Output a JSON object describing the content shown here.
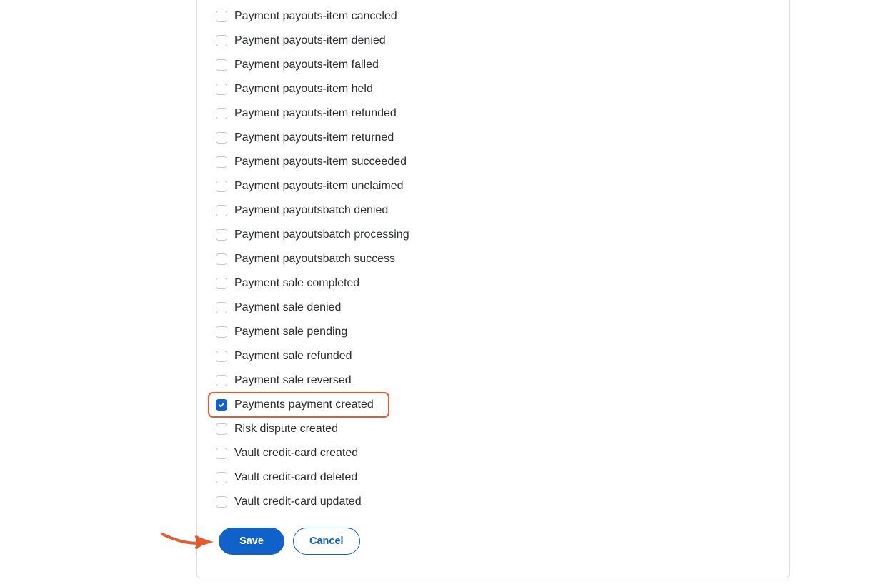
{
  "events": [
    {
      "label": "Payment payouts-item canceled",
      "checked": false,
      "highlight": false
    },
    {
      "label": "Payment payouts-item denied",
      "checked": false,
      "highlight": false
    },
    {
      "label": "Payment payouts-item failed",
      "checked": false,
      "highlight": false
    },
    {
      "label": "Payment payouts-item held",
      "checked": false,
      "highlight": false
    },
    {
      "label": "Payment payouts-item refunded",
      "checked": false,
      "highlight": false
    },
    {
      "label": "Payment payouts-item returned",
      "checked": false,
      "highlight": false
    },
    {
      "label": "Payment payouts-item succeeded",
      "checked": false,
      "highlight": false
    },
    {
      "label": "Payment payouts-item unclaimed",
      "checked": false,
      "highlight": false
    },
    {
      "label": "Payment payoutsbatch denied",
      "checked": false,
      "highlight": false
    },
    {
      "label": "Payment payoutsbatch processing",
      "checked": false,
      "highlight": false
    },
    {
      "label": "Payment payoutsbatch success",
      "checked": false,
      "highlight": false
    },
    {
      "label": "Payment sale completed",
      "checked": false,
      "highlight": false
    },
    {
      "label": "Payment sale denied",
      "checked": false,
      "highlight": false
    },
    {
      "label": "Payment sale pending",
      "checked": false,
      "highlight": false
    },
    {
      "label": "Payment sale refunded",
      "checked": false,
      "highlight": false
    },
    {
      "label": "Payment sale reversed",
      "checked": false,
      "highlight": false
    },
    {
      "label": "Payments payment created",
      "checked": true,
      "highlight": true
    },
    {
      "label": "Risk dispute created",
      "checked": false,
      "highlight": false
    },
    {
      "label": "Vault credit-card created",
      "checked": false,
      "highlight": false
    },
    {
      "label": "Vault credit-card deleted",
      "checked": false,
      "highlight": false
    },
    {
      "label": "Vault credit-card updated",
      "checked": false,
      "highlight": false
    }
  ],
  "buttons": {
    "save": "Save",
    "cancel": "Cancel"
  },
  "colors": {
    "primary": "#1161ca",
    "annotation": "#e8592b"
  }
}
